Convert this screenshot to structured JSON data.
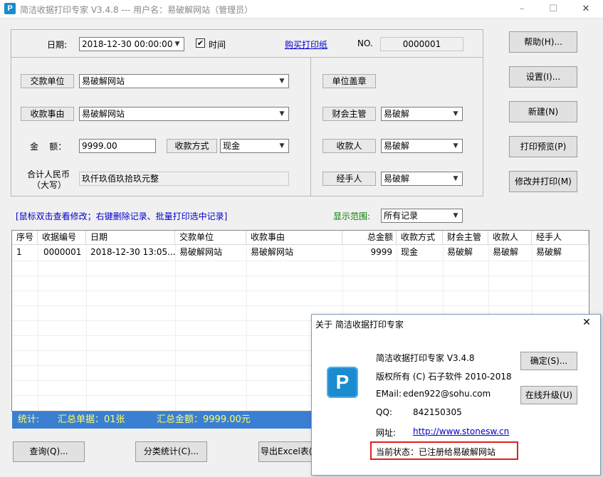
{
  "window": {
    "title": "简洁收据打印专家 V3.4.8 --- 用户名：易破解网站（管理员）",
    "minimize": "–",
    "maximize": "☐",
    "close": "✕",
    "app_icon": "P"
  },
  "form": {
    "date_label": "日期:",
    "date_value": "2018-12-30 00:00:00",
    "time_checkbox_label": "时间",
    "buy_paper_link": "购买打印纸",
    "no_label": "NO.",
    "no_value": "0000001",
    "payer_button": "交款单位",
    "payer_value": "易破解网站",
    "reason_button": "收款事由",
    "reason_value": "易破解网站",
    "amount_label": "金    额：",
    "amount_value": "9999.00",
    "method_button": "收款方式",
    "method_value": "现金",
    "total_rmb_label_1": "合计人民币",
    "total_rmb_label_2": "（大写）",
    "total_rmb_value": "玖仟玖佰玖拾玖元整",
    "seal_button": "单位盖章",
    "finance_button": "财会主管",
    "finance_value": "易破解",
    "receiver_button": "收款人",
    "receiver_value": "易破解",
    "handler_button": "经手人",
    "handler_value": "易破解"
  },
  "side_buttons": {
    "help": "帮助(H)...",
    "settings": "设置(I)...",
    "new": "新建(N)",
    "preview": "打印预览(P)",
    "modify_print": "修改并打印(M)"
  },
  "hint": "[鼠标双击查看修改；右键删除记录、批量打印选中记录]",
  "range_label": "显示范围:",
  "range_value": "所有记录",
  "table": {
    "headers": [
      "序号",
      "收据编号",
      "日期",
      "交款单位",
      "收款事由",
      "总金额",
      "收款方式",
      "财会主管",
      "收款人",
      "经手人"
    ],
    "rows": [
      [
        "1",
        "0000001",
        "2018-12-30 13:05...",
        "易破解网站",
        "易破解网站",
        "9999",
        "现金",
        "易破解",
        "易破解",
        "易破解"
      ]
    ]
  },
  "status": {
    "prefix": "统计:",
    "count": "汇总单据：01张",
    "sum": "汇总金额：9999.00元"
  },
  "bottom_buttons": {
    "query": "查询(Q)...",
    "category": "分类统计(C)...",
    "export": "导出Excel表(E"
  },
  "about": {
    "title": "关于 简洁收据打印专家",
    "close": "✕",
    "product": "简洁收据打印专家 V3.4.8",
    "copyright": "版权所有 (C) 石子软件 2010-2018",
    "email_label": "EMail:",
    "email_value": "eden922@sohu.com",
    "qq_label": "QQ:",
    "qq_value": "842150305",
    "site_label": "网址:",
    "site_value": "http://www.stonesw.cn",
    "status_text": "当前状态：已注册给易破解网站",
    "ok_button": "确定(S)...",
    "upgrade_button": "在线升级(U)",
    "logo_letter": "P"
  },
  "colors": {
    "status_bar": "#3a7fd1",
    "status_text": "#ffff66",
    "hint_text": "#0000cc",
    "range_label": "#008000",
    "highlight_border": "#e02020",
    "logo": "#1b8bd0"
  }
}
